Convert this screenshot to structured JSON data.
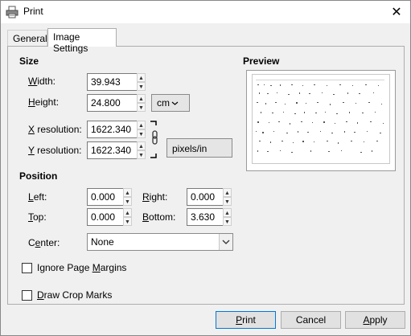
{
  "window": {
    "title": "Print",
    "close_glyph": "✕",
    "app_icon": "printer-icon"
  },
  "tabs": [
    {
      "label": "General",
      "active": false
    },
    {
      "label": "Image Settings",
      "active": true
    }
  ],
  "size": {
    "heading": "Size",
    "width": {
      "label_underlined": "W",
      "label_rest": "idth:",
      "value": "39.943"
    },
    "height": {
      "label_underlined": "H",
      "label_rest": "eight:",
      "value": "24.800"
    },
    "unit": "cm",
    "x_resolution": {
      "label_underlined": "X",
      "label_rest": " resolution:",
      "value": "1622.340"
    },
    "y_resolution": {
      "label_underlined": "Y",
      "label_rest": " resolution:",
      "value": "1622.340"
    },
    "resolution_unit": "pixels/in"
  },
  "position": {
    "heading": "Position",
    "left": {
      "label_underlined": "L",
      "label_rest": "eft:",
      "value": "0.000"
    },
    "right": {
      "label_underlined": "R",
      "label_rest": "ight:",
      "value": "0.000"
    },
    "top": {
      "label_underlined": "T",
      "label_rest": "op:",
      "value": "0.000"
    },
    "bottom": {
      "label_underlined": "B",
      "label_rest": "ottom:",
      "value": "3.630"
    },
    "center": {
      "label_prefix": "C",
      "label_underlined": "e",
      "label_rest": "nter:",
      "value": "None"
    }
  },
  "options": {
    "ignore_margins": {
      "label_prefix": "Ignore Page ",
      "label_underlined": "M",
      "label_rest": "argins",
      "checked": false
    },
    "crop_marks": {
      "label_prefix": "",
      "label_underlined": "D",
      "label_rest": "raw Crop Marks",
      "checked": false
    }
  },
  "preview": {
    "heading": "Preview"
  },
  "buttons": {
    "print": {
      "label_underlined": "P",
      "label_rest": "rint"
    },
    "cancel": "Cancel",
    "apply": {
      "label_underlined": "A",
      "label_rest": "pply"
    }
  }
}
